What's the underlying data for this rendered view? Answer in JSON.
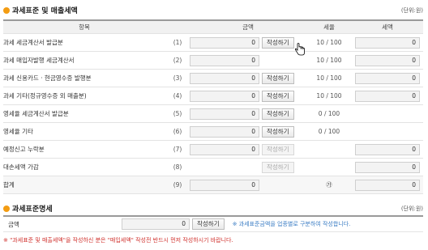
{
  "section1": {
    "title": "과세표준 및 매출세액",
    "unit": "(단위:원)"
  },
  "headers": {
    "item": "항목",
    "amount": "금액",
    "rate": "세율",
    "tax": "세액"
  },
  "rows": [
    {
      "label": "과세 세금계산서 발급분",
      "no": "(1)",
      "amount": "0",
      "button": "작성하기",
      "button_enabled": true,
      "rate": "10 / 100",
      "tax": "0"
    },
    {
      "label": "과세 매입자발행 세금계산서",
      "no": "(2)",
      "amount": "0",
      "button": "",
      "button_enabled": false,
      "rate": "10 / 100",
      "tax": "0"
    },
    {
      "label": "과세 신용카드 · 현금영수증 발행분",
      "no": "(3)",
      "amount": "0",
      "button": "작성하기",
      "button_enabled": true,
      "rate": "10 / 100",
      "tax": "0"
    },
    {
      "label": "과세 기타(정규영수증 외 매출분)",
      "no": "(4)",
      "amount": "0",
      "button": "작성하기",
      "button_enabled": true,
      "rate": "10 / 100",
      "tax": "0"
    },
    {
      "label": "영세율 세금계산서 발급분",
      "no": "(5)",
      "amount": "0",
      "button": "작성하기",
      "button_enabled": true,
      "rate": "0 / 100",
      "tax": ""
    },
    {
      "label": "영세율 기타",
      "no": "(6)",
      "amount": "0",
      "button": "작성하기",
      "button_enabled": true,
      "rate": "0 / 100",
      "tax": ""
    },
    {
      "label": "예정신고 누락분",
      "no": "(7)",
      "amount": "0",
      "button": "작성하기",
      "button_enabled": false,
      "rate": "",
      "tax": "0"
    },
    {
      "label": "대손세액 가감",
      "no": "(8)",
      "amount": "",
      "button": "작성하기",
      "button_enabled": false,
      "rate": "",
      "tax": "0"
    },
    {
      "label": "합계",
      "no": "(9)",
      "amount": "0",
      "button": "",
      "button_enabled": false,
      "rate": "㉮",
      "tax": "0"
    }
  ],
  "section2": {
    "title": "과세표준명세",
    "unit": "(단위:원)",
    "label": "금액",
    "amount": "0",
    "button": "작성하기",
    "note": "※ 과세표준금액을 업종별로 구분하여 작성합니다."
  },
  "warning": "※ \"과세표준 및 매출세액\"을 작성하신 분은 \"매입세액\" 작성전 반드시 먼저 작성하시기 바랍니다.",
  "colors": {
    "bullet": "#f39c12",
    "warning": "#d0312d",
    "note": "#3b7dc4"
  }
}
